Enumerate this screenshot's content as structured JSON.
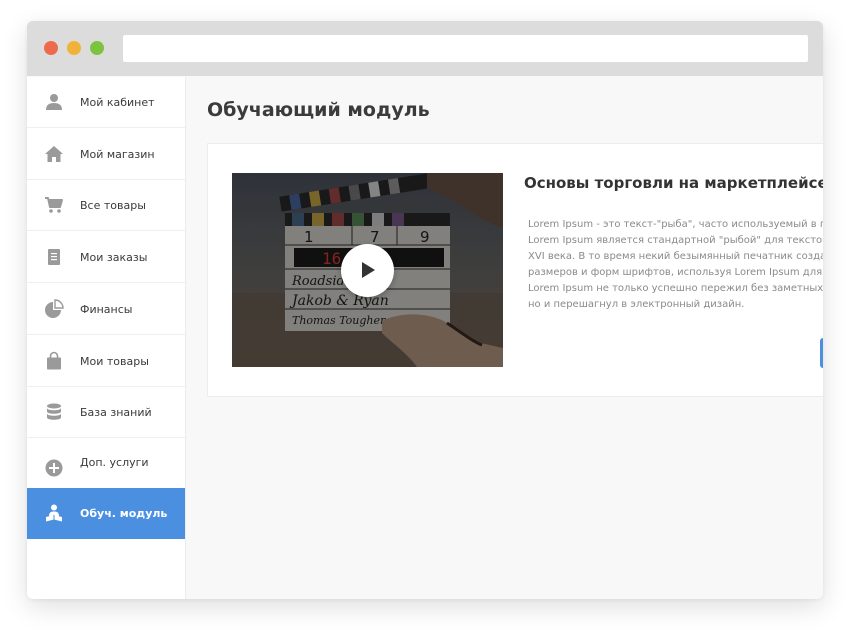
{
  "colors": {
    "accent": "#4a8fe0",
    "dot_red": "#ee6a4c",
    "dot_yellow": "#f0b33a",
    "dot_green": "#7dc241",
    "nav_icon": "#9a9a9a"
  },
  "browser": {
    "address_value": ""
  },
  "sidebar": {
    "items": [
      {
        "label": "Мой кабинет",
        "icon": "user-icon"
      },
      {
        "label": "Мой магазин",
        "icon": "home-icon"
      },
      {
        "label": "Все товары",
        "icon": "cart-icon"
      },
      {
        "label": "Мои заказы",
        "icon": "document-icon"
      },
      {
        "label": "Финансы",
        "icon": "pie-chart-icon"
      },
      {
        "label": "Мои товары",
        "icon": "shopping-bag-icon"
      },
      {
        "label": "База знаний",
        "icon": "database-icon"
      },
      {
        "label": "Доп. услуги",
        "icon": "plus-circle-icon"
      },
      {
        "label": "Обуч. модуль",
        "icon": "training-icon",
        "active": true
      }
    ]
  },
  "main": {
    "title": "Обучающий модуль",
    "course": {
      "title": "Основы торговли на маркетплейсе",
      "description_lines": [
        "Lorem Ipsum - это текст-\"рыба\", часто используемый в п",
        "Lorem Ipsum является стандартной \"рыбой\" для текстов",
        "XVI века. В то время некий безымянный печатник созда",
        "размеров и форм шрифтов, используя Lorem Ipsum для",
        "Lorem Ipsum не только успешно пережил без заметных",
        "но и перешагнул в электронный дизайн."
      ],
      "video": {
        "clapper_scene": "1",
        "clapper_take": "7",
        "clapper_roll": "9",
        "timecode": "16.21",
        "production": "Roadside",
        "director": "Jakob & Ryan",
        "camera": "Thomas Tougher",
        "play_icon": "play-icon"
      }
    }
  }
}
